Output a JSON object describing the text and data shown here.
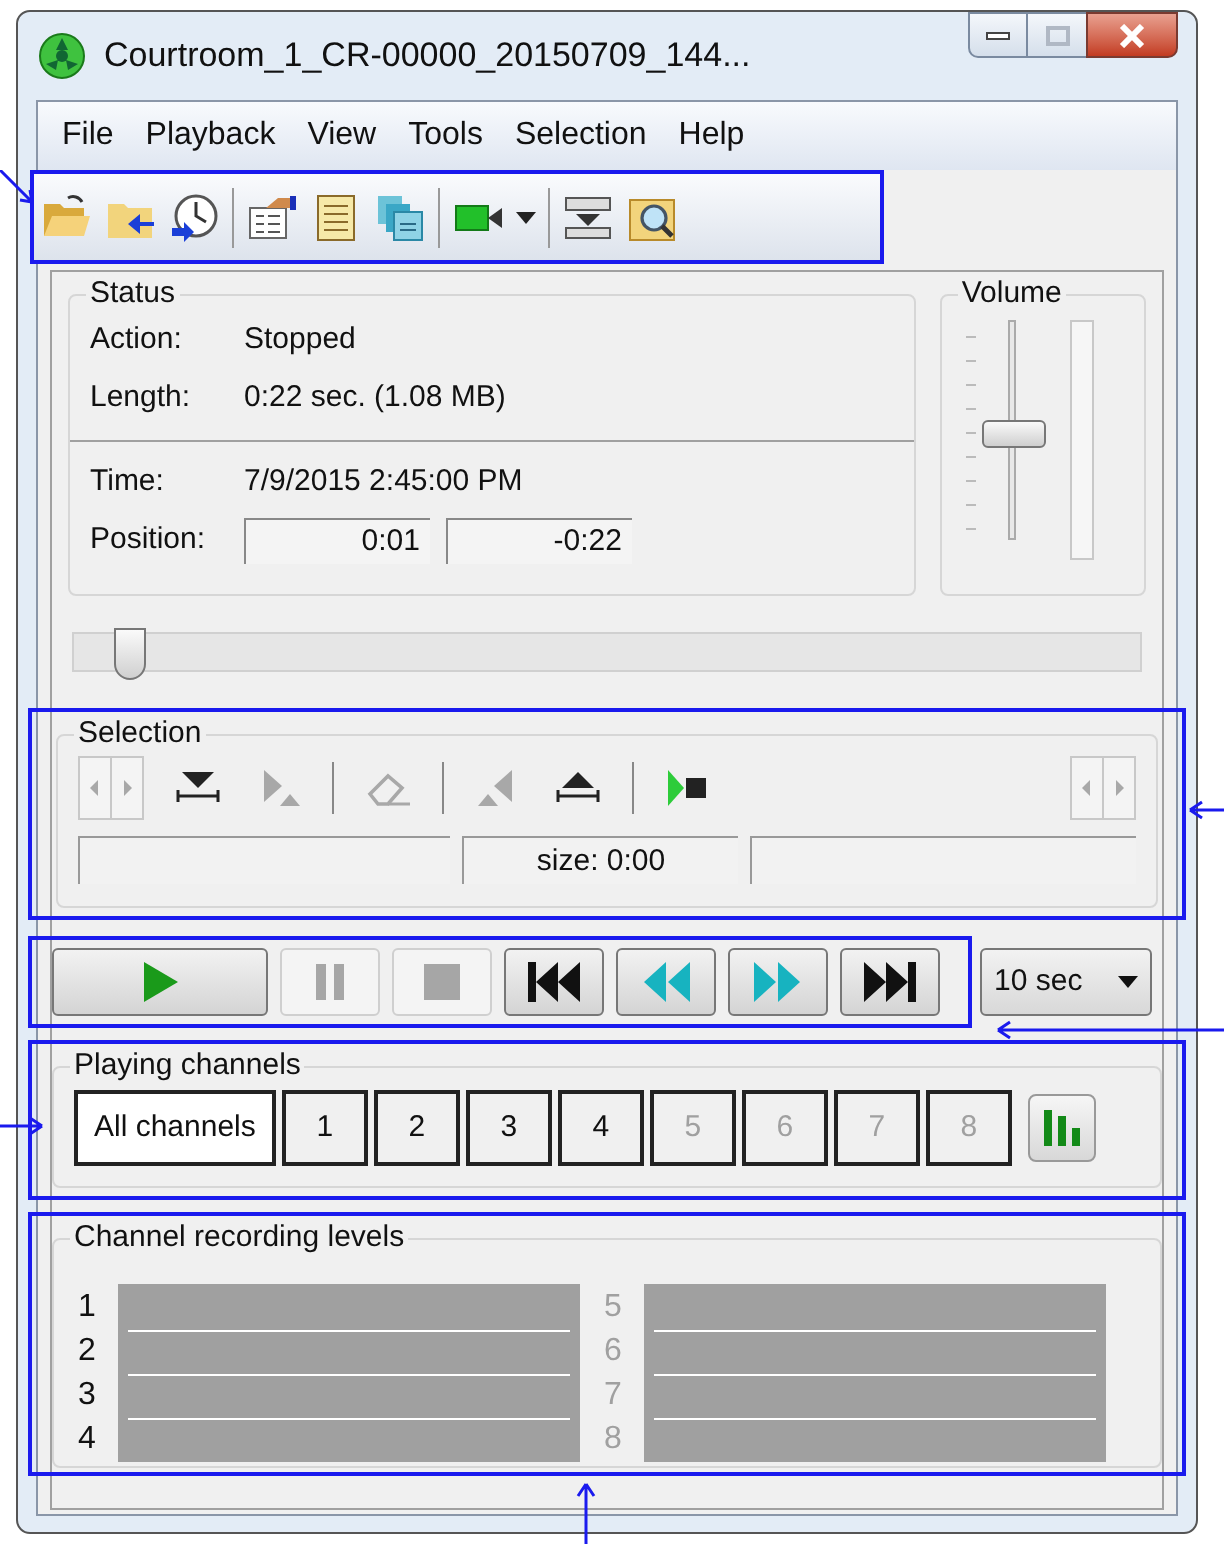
{
  "window": {
    "title": "Courtroom_1_CR-00000_20150709_144...",
    "maximize_disabled": true
  },
  "menu": [
    "File",
    "Playback",
    "View",
    "Tools",
    "Selection",
    "Help"
  ],
  "toolbar": [
    {
      "kind": "open"
    },
    {
      "kind": "import"
    },
    {
      "kind": "history"
    },
    {
      "kind": "separator"
    },
    {
      "kind": "properties"
    },
    {
      "kind": "notes"
    },
    {
      "kind": "documents"
    },
    {
      "kind": "separator"
    },
    {
      "kind": "camera"
    },
    {
      "kind": "separator"
    },
    {
      "kind": "filter"
    },
    {
      "kind": "search"
    }
  ],
  "status": {
    "title": "Status",
    "rows": [
      {
        "label": "Action:",
        "value": "Stopped"
      },
      {
        "label": "Length:",
        "value": "0:22 sec. (1.08 MB)"
      }
    ],
    "time": {
      "label": "Time:",
      "value": "7/9/2015 2:45:00 PM"
    },
    "position": {
      "label": "Position:",
      "elapsed": "0:01",
      "remaining": "-0:22"
    }
  },
  "volume": {
    "title": "Volume",
    "level": 0.5
  },
  "position_slider": {
    "level": 0.04
  },
  "selection": {
    "title": "Selection",
    "tools": [
      {
        "kind": "spin",
        "disabled": true
      },
      {
        "kind": "mark-start",
        "disabled": false
      },
      {
        "kind": "trim",
        "disabled": true
      },
      {
        "kind": "separator"
      },
      {
        "kind": "erase",
        "disabled": true
      },
      {
        "kind": "separator"
      },
      {
        "kind": "trim-left",
        "disabled": true
      },
      {
        "kind": "mark-end",
        "disabled": false
      },
      {
        "kind": "separator"
      },
      {
        "kind": "play-selection",
        "disabled": false
      },
      {
        "kind": "spacer"
      },
      {
        "kind": "spin",
        "disabled": true
      }
    ],
    "size": "size: 0:00"
  },
  "transport": [
    {
      "kind": "play",
      "disabled": false
    },
    {
      "kind": "pause",
      "disabled": true
    },
    {
      "kind": "stop",
      "disabled": true
    },
    {
      "kind": "first",
      "disabled": false
    },
    {
      "kind": "rewind",
      "disabled": false
    },
    {
      "kind": "forward",
      "disabled": false
    },
    {
      "kind": "last",
      "disabled": false
    }
  ],
  "skip_interval": "10 sec",
  "playing_channels": {
    "title": "Playing channels",
    "channels": [
      {
        "label": "All channels",
        "selected": true,
        "disabled": false
      },
      {
        "label": "1",
        "selected": false,
        "disabled": false
      },
      {
        "label": "2",
        "selected": false,
        "disabled": false
      },
      {
        "label": "3",
        "selected": false,
        "disabled": false
      },
      {
        "label": "4",
        "selected": false,
        "disabled": false
      },
      {
        "label": "5",
        "selected": false,
        "disabled": true
      },
      {
        "label": "6",
        "selected": false,
        "disabled": true
      },
      {
        "label": "7",
        "selected": false,
        "disabled": true
      },
      {
        "label": "8",
        "selected": false,
        "disabled": true
      }
    ]
  },
  "recording_levels": {
    "title": "Channel recording levels",
    "groups": [
      [
        {
          "label": "1",
          "disabled": false
        },
        {
          "label": "2",
          "disabled": false
        },
        {
          "label": "3",
          "disabled": false
        },
        {
          "label": "4",
          "disabled": false
        }
      ],
      [
        {
          "label": "5",
          "disabled": true
        },
        {
          "label": "6",
          "disabled": true
        },
        {
          "label": "7",
          "disabled": true
        },
        {
          "label": "8",
          "disabled": true
        }
      ]
    ]
  }
}
